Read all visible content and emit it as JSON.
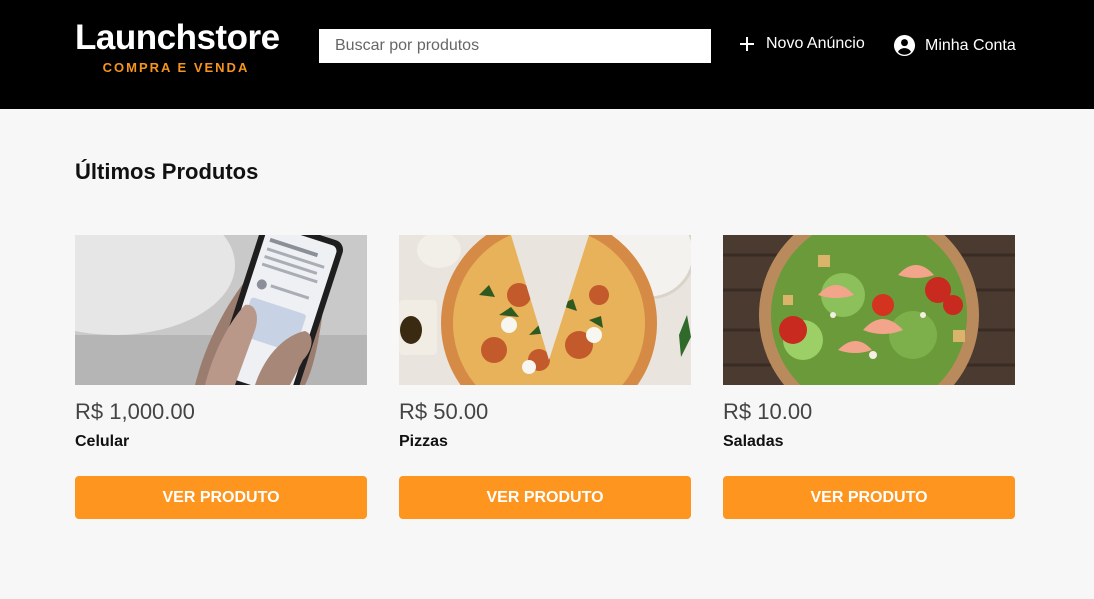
{
  "brand": {
    "title": "Launchstore",
    "subtitle": "COMPRA E VENDA",
    "accent": "#f7941d"
  },
  "search": {
    "placeholder": "Buscar por produtos",
    "value": ""
  },
  "nav": {
    "new_ad": "Novo Anúncio",
    "account": "Minha Conta"
  },
  "section_title": "Últimos Produtos",
  "products": [
    {
      "price": "R$ 1,000.00",
      "name": "Celular",
      "cta": "VER PRODUTO",
      "image": "phone-in-hand"
    },
    {
      "price": "R$ 50.00",
      "name": "Pizzas",
      "cta": "VER PRODUTO",
      "image": "pizza"
    },
    {
      "price": "R$ 10.00",
      "name": "Saladas",
      "cta": "VER PRODUTO",
      "image": "shrimp-salad"
    }
  ],
  "colors": {
    "header_bg": "#000000",
    "page_bg": "#f7f7f7",
    "button": "#fd951f"
  }
}
